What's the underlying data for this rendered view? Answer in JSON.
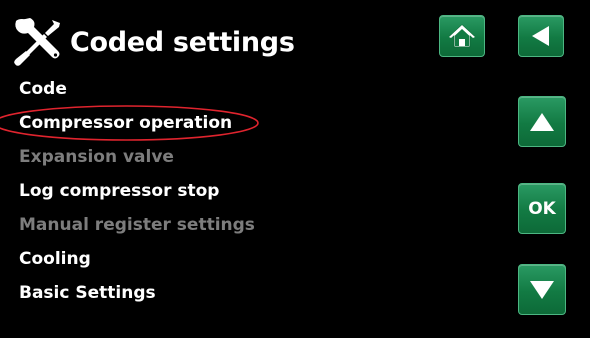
{
  "header": {
    "title": "Coded settings",
    "icon": "tools-icon"
  },
  "menu": {
    "items": [
      {
        "label": "Code",
        "enabled": true
      },
      {
        "label": "Compressor operation",
        "enabled": true,
        "highlighted": true
      },
      {
        "label": "Expansion valve",
        "enabled": false
      },
      {
        "label": "Log compressor stop",
        "enabled": true
      },
      {
        "label": "Manual register settings",
        "enabled": false
      },
      {
        "label": "Cooling",
        "enabled": true
      },
      {
        "label": "Basic Settings",
        "enabled": true
      }
    ]
  },
  "buttons": {
    "home_icon": "home-icon",
    "back_icon": "back-arrow-icon",
    "up_icon": "arrow-up-icon",
    "ok_label": "OK",
    "down_icon": "arrow-down-icon"
  },
  "colors": {
    "background": "#000000",
    "text_enabled": "#ffffff",
    "text_disabled": "#7d7d7d",
    "button_green": "#127a43",
    "highlight_ring": "#e0242e"
  }
}
